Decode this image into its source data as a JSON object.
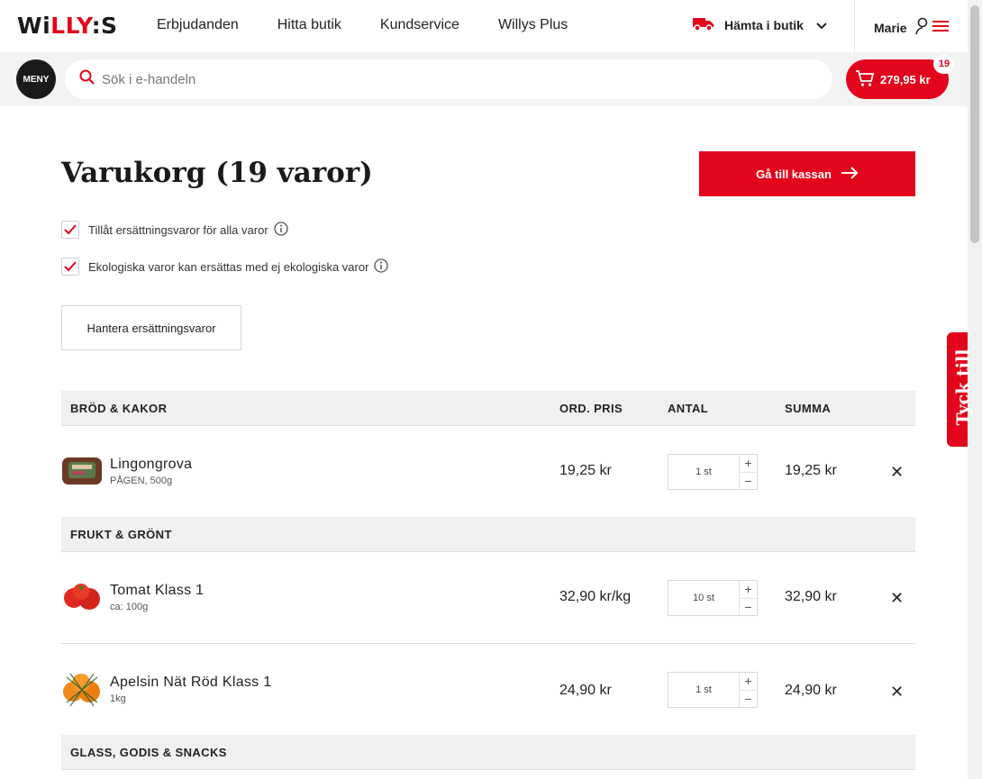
{
  "header": {
    "logo_a": "WiLL",
    "logo_b": "Y:S",
    "nav": [
      "Erbjudanden",
      "Hitta butik",
      "Kundservice",
      "Willys Plus"
    ],
    "delivery_label": "Hämta i butik",
    "user_name": "Marie"
  },
  "searchbar": {
    "menu_label": "MENY",
    "placeholder": "Sök i e-handeln",
    "cart_total": "279,95 kr",
    "cart_count": "19"
  },
  "feedback_label": "Tyck till",
  "page": {
    "title": "Varukorg (19 varor)",
    "checkout_label": "Gå till kassan",
    "option_substitute_all": "Tillåt ersättningsvaror för alla varor",
    "option_organic": "Ekologiska varor kan ersättas med ej ekologiska varor",
    "manage_label": "Hantera ersättningsvaror"
  },
  "table": {
    "col_price": "ORD. PRIS",
    "col_qty": "ANTAL",
    "col_sum": "SUMMA",
    "categories": [
      {
        "name": "BRÖD & KAKOR",
        "items": [
          {
            "name": "Lingongrova",
            "sub": "PÅGEN, 500g",
            "price": "19,25 kr",
            "qty": "1 st",
            "sum": "19,25 kr"
          }
        ]
      },
      {
        "name": "FRUKT & GRÖNT",
        "items": [
          {
            "name": "Tomat Klass 1",
            "sub": "ca: 100g",
            "price": "32,90 kr/kg",
            "qty": "10 st",
            "sum": "32,90 kr"
          },
          {
            "name": "Apelsin Nät Röd Klass 1",
            "sub": "1kg",
            "price": "24,90 kr",
            "qty": "1 st",
            "sum": "24,90 kr"
          }
        ]
      },
      {
        "name": "GLASS, GODIS & SNACKS",
        "items": []
      }
    ]
  },
  "colors": {
    "brand_red": "#e3051b",
    "dark": "#1a1a1a",
    "band_gray": "#f0f0f0"
  }
}
